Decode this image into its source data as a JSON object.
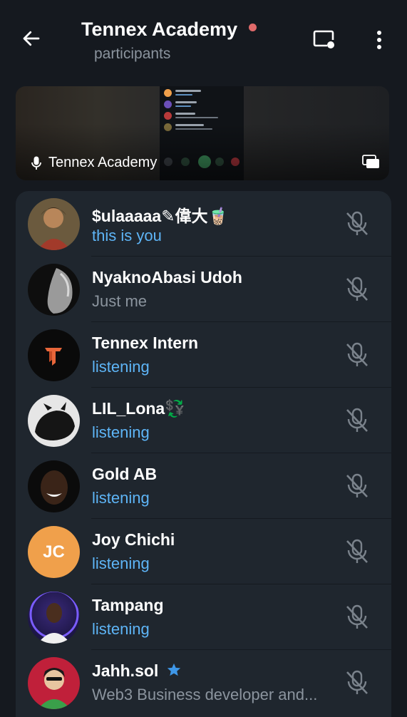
{
  "header": {
    "title": "Tennex Academy",
    "subtitle": "participants",
    "accent_recording": "#e06a6a"
  },
  "preview": {
    "label": "Tennex Academy"
  },
  "participants": [
    {
      "name": "$ulaaaaa✎偉大🧋",
      "status": "this is you",
      "status_color": "blue",
      "muted": true
    },
    {
      "name": "NyaknoAbasi Udoh",
      "status": "Just me",
      "status_color": "grey",
      "muted": true
    },
    {
      "name": "Tennex Intern",
      "status": "listening",
      "status_color": "blue",
      "muted": true
    },
    {
      "name": "LIL_Lona💱",
      "status": "listening",
      "status_color": "blue",
      "muted": true
    },
    {
      "name": "Gold AB",
      "status": "listening",
      "status_color": "blue",
      "muted": true
    },
    {
      "name": "Joy Chichi",
      "initials": "JC",
      "status": "listening",
      "status_color": "blue",
      "muted": true
    },
    {
      "name": "Tampang",
      "status": "listening",
      "status_color": "blue",
      "muted": true
    },
    {
      "name": "Jahh.sol",
      "status": "Web3 Business developer and...",
      "status_color": "grey",
      "verified": true,
      "muted": true
    }
  ],
  "colors": {
    "background": "#15191f",
    "list_background": "#1f262e",
    "status_blue": "#5eb5f7",
    "status_grey": "#8b949e",
    "verified_star": "#3e97e8",
    "joy_avatar": "#f0a04b"
  },
  "icons": {
    "back": "arrow-left-icon",
    "screen_share": "screen-record-icon",
    "more": "more-vertical-icon",
    "mic": "microphone-icon",
    "pip": "picture-in-picture-icon",
    "muted": "mic-off-icon",
    "verified": "star-icon"
  }
}
